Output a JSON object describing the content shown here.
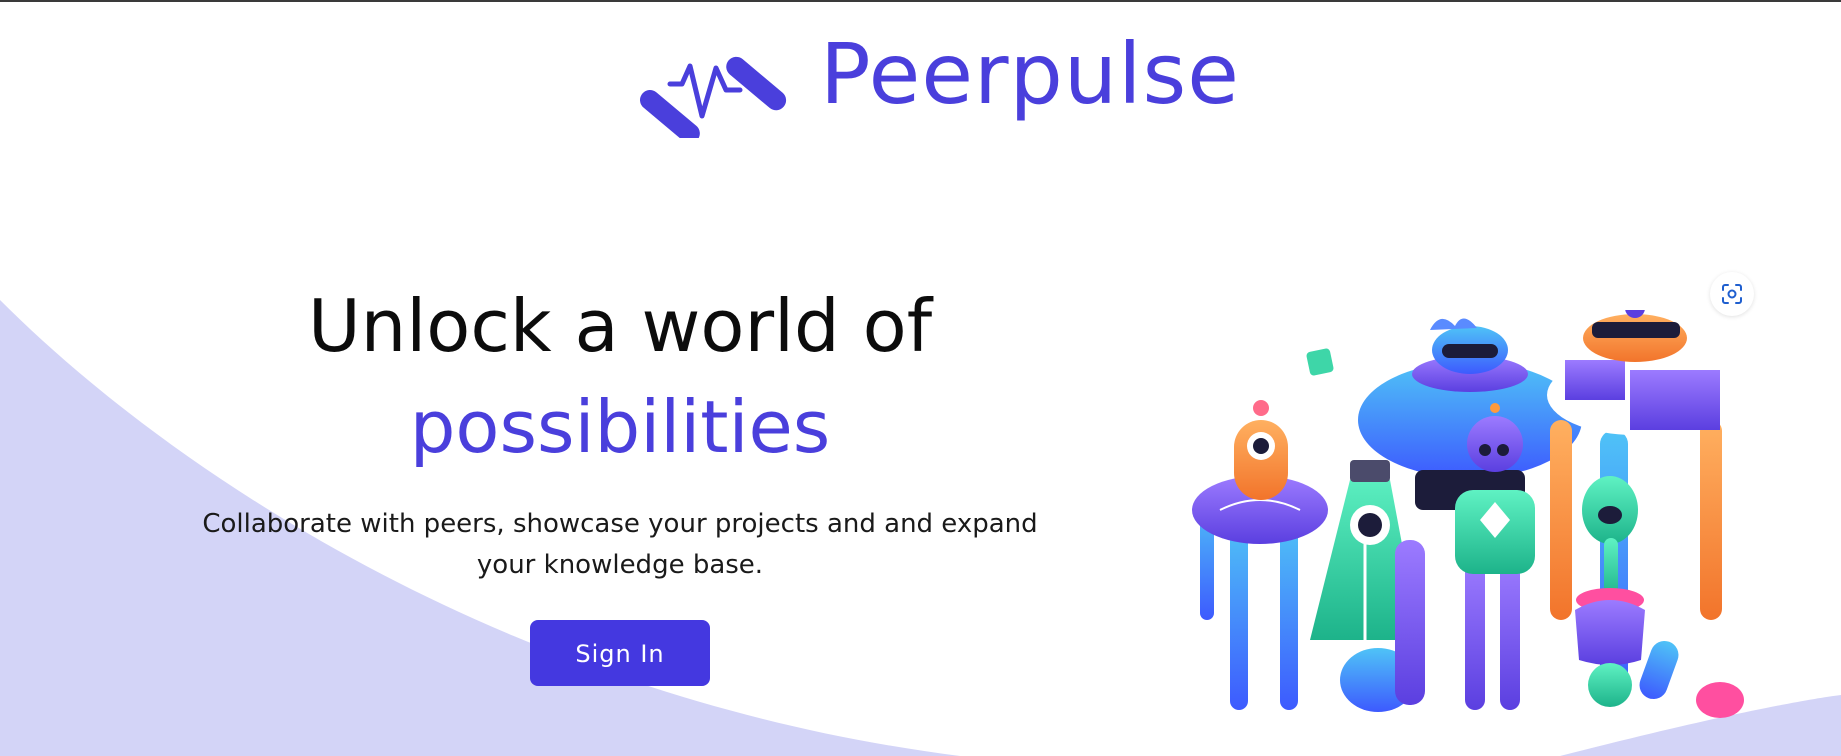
{
  "brand": {
    "name": "Peerpulse",
    "color": "#4a3fdc"
  },
  "hero": {
    "headline_part1": "Unlock a world of",
    "headline_part2": "possibilities",
    "subtitle": "Collaborate with peers, showcase your projects and and expand your knowledge base.",
    "accent_color": "#4a3fdc"
  },
  "signin": {
    "label": "Sign In",
    "color": "#4438e0"
  },
  "background": {
    "wave_color": "#d3d4f7"
  },
  "icons": {
    "capture": "visual-search-icon",
    "logo_mark": "pulse-wave-icon"
  }
}
